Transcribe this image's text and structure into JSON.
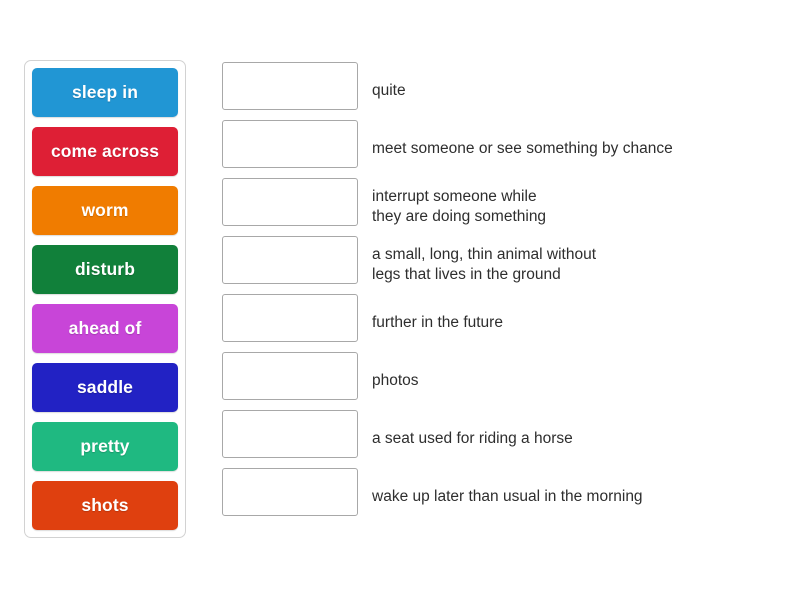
{
  "activity": {
    "type": "match-up",
    "tile_text_color": "#ffffff",
    "definition_text_color": "#2e2e2e",
    "panel_border_color": "#d2d2d2",
    "dropzone_border_color": "#a8a8a8",
    "background_color": "#ffffff"
  },
  "tiles": [
    {
      "label": "sleep in",
      "color": "#2196d4"
    },
    {
      "label": "come across",
      "color": "#de1f35"
    },
    {
      "label": "worm",
      "color": "#f07c00"
    },
    {
      "label": "disturb",
      "color": "#11803a"
    },
    {
      "label": "ahead of",
      "color": "#c845d8"
    },
    {
      "label": "saddle",
      "color": "#2222c4"
    },
    {
      "label": "pretty",
      "color": "#1fb981"
    },
    {
      "label": "shots",
      "color": "#df400f"
    }
  ],
  "answers": [
    {
      "dropzone_value": "",
      "definition": "quite"
    },
    {
      "dropzone_value": "",
      "definition": "meet someone or see something by chance"
    },
    {
      "dropzone_value": "",
      "definition": "interrupt someone while\nthey are doing something"
    },
    {
      "dropzone_value": "",
      "definition": "a small, long, thin animal without\nlegs that lives in the ground"
    },
    {
      "dropzone_value": "",
      "definition": "further in the future"
    },
    {
      "dropzone_value": "",
      "definition": "photos"
    },
    {
      "dropzone_value": "",
      "definition": "a seat used for riding a horse"
    },
    {
      "dropzone_value": "",
      "definition": "wake up later than usual in the morning"
    }
  ]
}
